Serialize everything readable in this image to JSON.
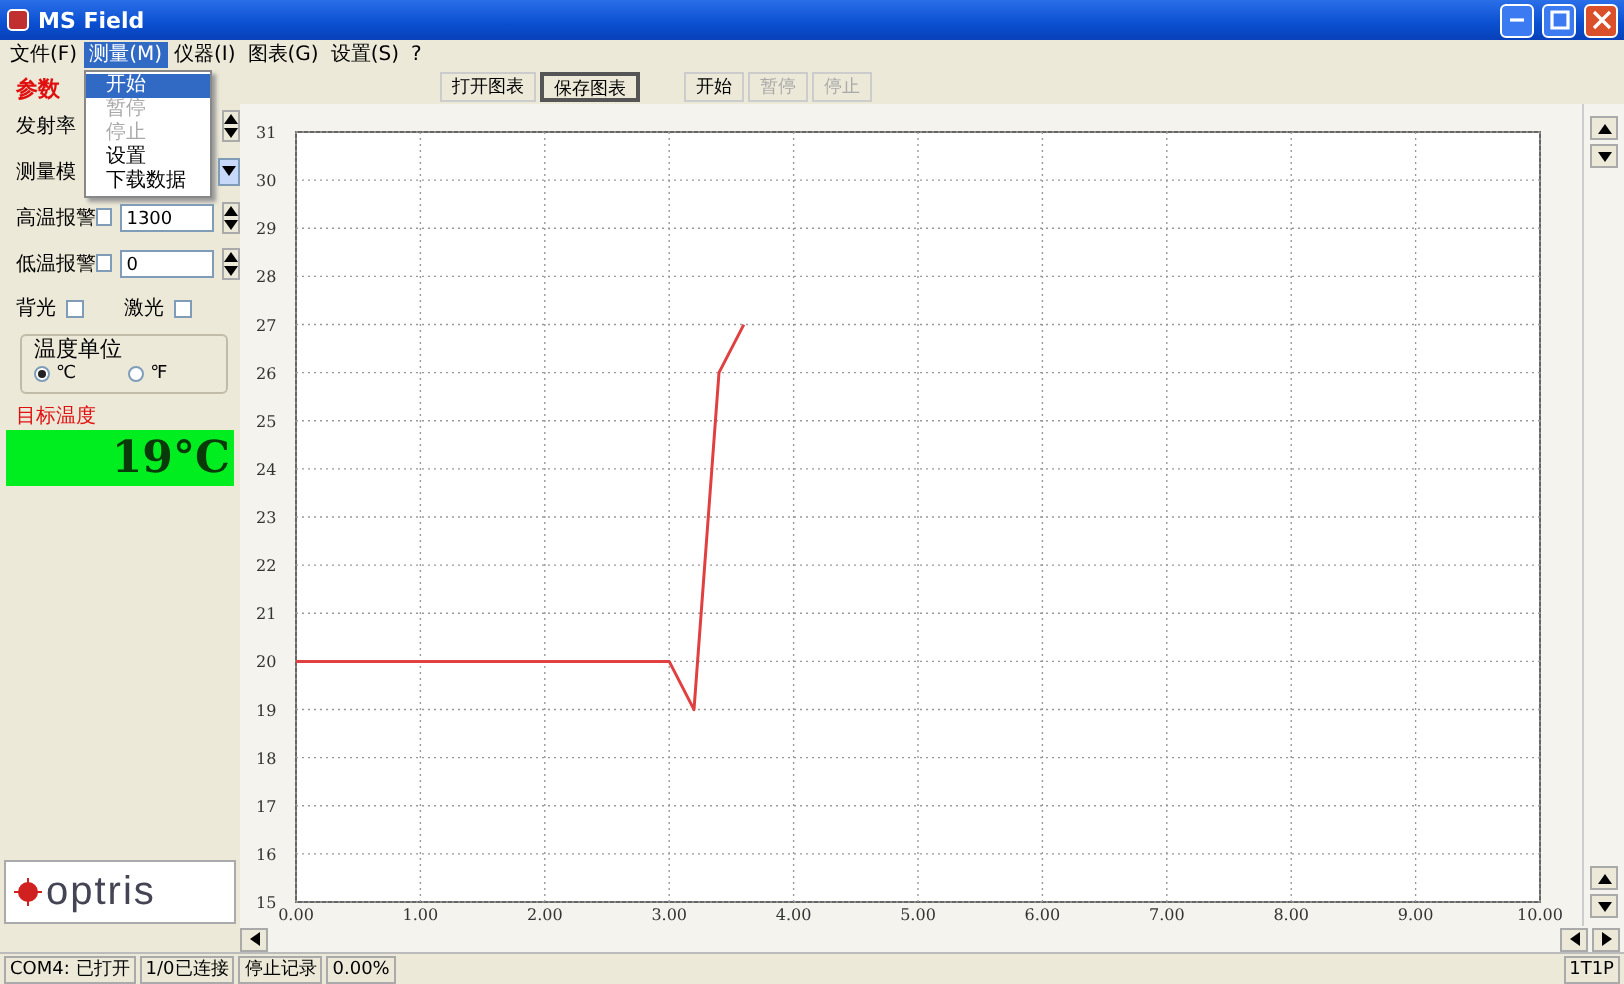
{
  "window": {
    "title": "MS Field"
  },
  "menu": [
    {
      "label": "文件(F)",
      "selected": false
    },
    {
      "label": "测量(M)",
      "selected": true
    },
    {
      "label": "仪器(I)",
      "selected": false
    },
    {
      "label": "图表(G)",
      "selected": false
    },
    {
      "label": "设置(S)",
      "selected": false
    },
    {
      "label": "?",
      "selected": false
    }
  ],
  "dropdown": [
    {
      "label": "开始",
      "selected": true,
      "disabled": false
    },
    {
      "label": "暂停",
      "selected": false,
      "disabled": true
    },
    {
      "label": "停止",
      "selected": false,
      "disabled": true
    },
    {
      "label": "设置",
      "selected": false,
      "disabled": false
    },
    {
      "label": "下载数据",
      "selected": false,
      "disabled": false
    }
  ],
  "panel": {
    "heading": "参数",
    "rows": [
      {
        "kind": "spin",
        "label": "发射率"
      },
      {
        "kind": "combo",
        "label": "测量模"
      },
      {
        "kind": "alarm",
        "label": "高温报警",
        "checked": false,
        "value": "1300"
      },
      {
        "kind": "alarm",
        "label": "低温报警",
        "checked": false,
        "value": "0"
      }
    ],
    "toggles": [
      {
        "label": "背光",
        "checked": false
      },
      {
        "label": "激光",
        "checked": false
      }
    ],
    "unit_group": {
      "title": "温度单位",
      "options": [
        {
          "label": "℃",
          "selected": true
        },
        {
          "label": "℉",
          "selected": false
        }
      ]
    },
    "target_label": "目标温度",
    "target_value": "19°C",
    "logo_text": "optris"
  },
  "toolbar": {
    "chart_buttons": [
      {
        "label": "打开图表",
        "selected": false,
        "disabled": false
      },
      {
        "label": "保存图表",
        "selected": true,
        "disabled": false
      }
    ],
    "measure_buttons": [
      {
        "label": "开始",
        "selected": false,
        "disabled": false
      },
      {
        "label": "暂停",
        "selected": false,
        "disabled": true
      },
      {
        "label": "停止",
        "selected": false,
        "disabled": true
      }
    ]
  },
  "chart": {
    "chart_data": {
      "type": "line",
      "x": [
        0,
        3.0,
        3.2,
        3.4,
        3.6
      ],
      "series": [
        {
          "color": "#e04040",
          "values": [
            20,
            20,
            19,
            26,
            27
          ]
        }
      ],
      "grid": true,
      "xlim": [
        0,
        10
      ],
      "ylim": [
        15,
        31
      ],
      "xticks": [
        {
          "value": 0,
          "label": "0.00"
        },
        {
          "value": 1,
          "label": "1.00"
        },
        {
          "value": 2,
          "label": "2.00"
        },
        {
          "value": 3,
          "label": "3.00"
        },
        {
          "value": 4,
          "label": "4.00"
        },
        {
          "value": 5,
          "label": "5.00"
        },
        {
          "value": 6,
          "label": "6.00"
        },
        {
          "value": 7,
          "label": "7.00"
        },
        {
          "value": 8,
          "label": "8.00"
        },
        {
          "value": 9,
          "label": "9.00"
        },
        {
          "value": 10,
          "label": "10.00"
        }
      ],
      "yticks": [
        15,
        16,
        17,
        18,
        19,
        20,
        21,
        22,
        23,
        24,
        25,
        26,
        27,
        28,
        29,
        30,
        31
      ]
    }
  },
  "status_bar": [
    "COM4: 已打开",
    "1/0已连接",
    "停止记录",
    "0.00%"
  ],
  "status_right": "1T1P"
}
